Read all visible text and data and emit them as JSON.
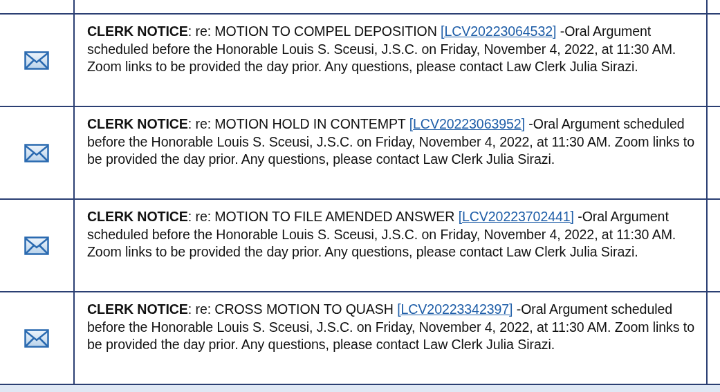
{
  "notices": [
    {
      "label": "CLERK NOTICE",
      "subject": ": re: MOTION TO COMPEL DEPOSITION ",
      "link": "[LCV20223064532]",
      "details": " -Oral Argument scheduled before the Honorable Louis S. Sceusi, J.S.C. on Friday, November 4, 2022, at 11:30 AM. Zoom links to be provided the day prior. Any questions, please contact Law Clerk Julia Sirazi."
    },
    {
      "label": "CLERK NOTICE",
      "subject": ": re: MOTION HOLD IN CONTEMPT ",
      "link": "[LCV20223063952]",
      "details": " -Oral Argument scheduled before the Honorable Louis S. Sceusi, J.S.C. on Friday, November 4, 2022, at 11:30 AM. Zoom links to be provided the day prior. Any questions, please contact Law Clerk Julia Sirazi."
    },
    {
      "label": "CLERK NOTICE",
      "subject": ": re: MOTION TO FILE AMENDED ANSWER ",
      "link": "[LCV20223702441]",
      "details": " -Oral Argument scheduled before the Honorable Louis S. Sceusi, J.S.C. on Friday, November 4, 2022, at 11:30 AM. Zoom links to be provided the day prior. Any questions, please contact Law Clerk Julia Sirazi."
    },
    {
      "label": "CLERK NOTICE",
      "subject": ": re: CROSS MOTION TO QUASH ",
      "link": "[LCV20223342397]",
      "details": " -Oral Argument scheduled before the Honorable Louis S. Sceusi, J.S.C. on Friday, November 4, 2022, at 11:30 AM. Zoom links to be provided the day prior. Any questions, please contact Law Clerk Julia Sirazi."
    }
  ]
}
